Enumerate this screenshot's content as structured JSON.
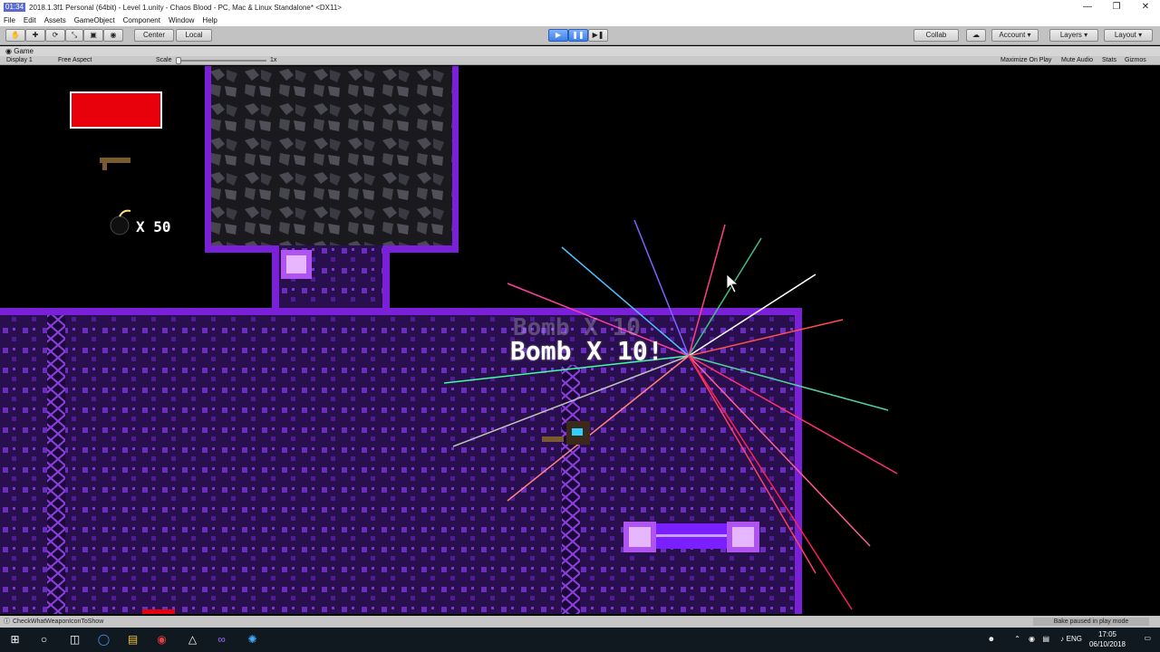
{
  "window": {
    "clock": "01:34",
    "title": "2018.1.3f1 Personal (64bit) - Level 1.unity - Chaos Blood - PC, Mac & Linux Standalone* <DX11>"
  },
  "menu": [
    "File",
    "Edit",
    "Assets",
    "GameObject",
    "Component",
    "Window",
    "Help"
  ],
  "toolbar": {
    "center_label": "Center",
    "local_label": "Local",
    "collab_label": "Collab",
    "account_label": "Account",
    "layers_label": "Layers",
    "layout_label": "Layout"
  },
  "game_panel": {
    "tab_label": "Game",
    "display_label": "Display 1",
    "aspect_label": "Free Aspect",
    "scale_label": "Scale",
    "scale_value": "1x",
    "maximize_label": "Maximize On Play",
    "mute_label": "Mute Audio",
    "stats_label": "Stats",
    "gizmos_label": "Gizmos"
  },
  "hud": {
    "bomb_count": "X 50",
    "pickup_message": "Bomb X 10!",
    "pickup_message_ghost": "Bomb X 10"
  },
  "status": {
    "message": "CheckWhatWeaponIconToShow",
    "bake_message": "Bake paused in play mode"
  },
  "taskbar": {
    "language": "ENG",
    "time": "17:05",
    "date": "06/10/2018"
  },
  "colors": {
    "health_bar": "#e8000a",
    "wall_purple": "#7a20d8",
    "floor_purple": "#3a1466",
    "unity_toolbar": "#c2c2c2"
  }
}
